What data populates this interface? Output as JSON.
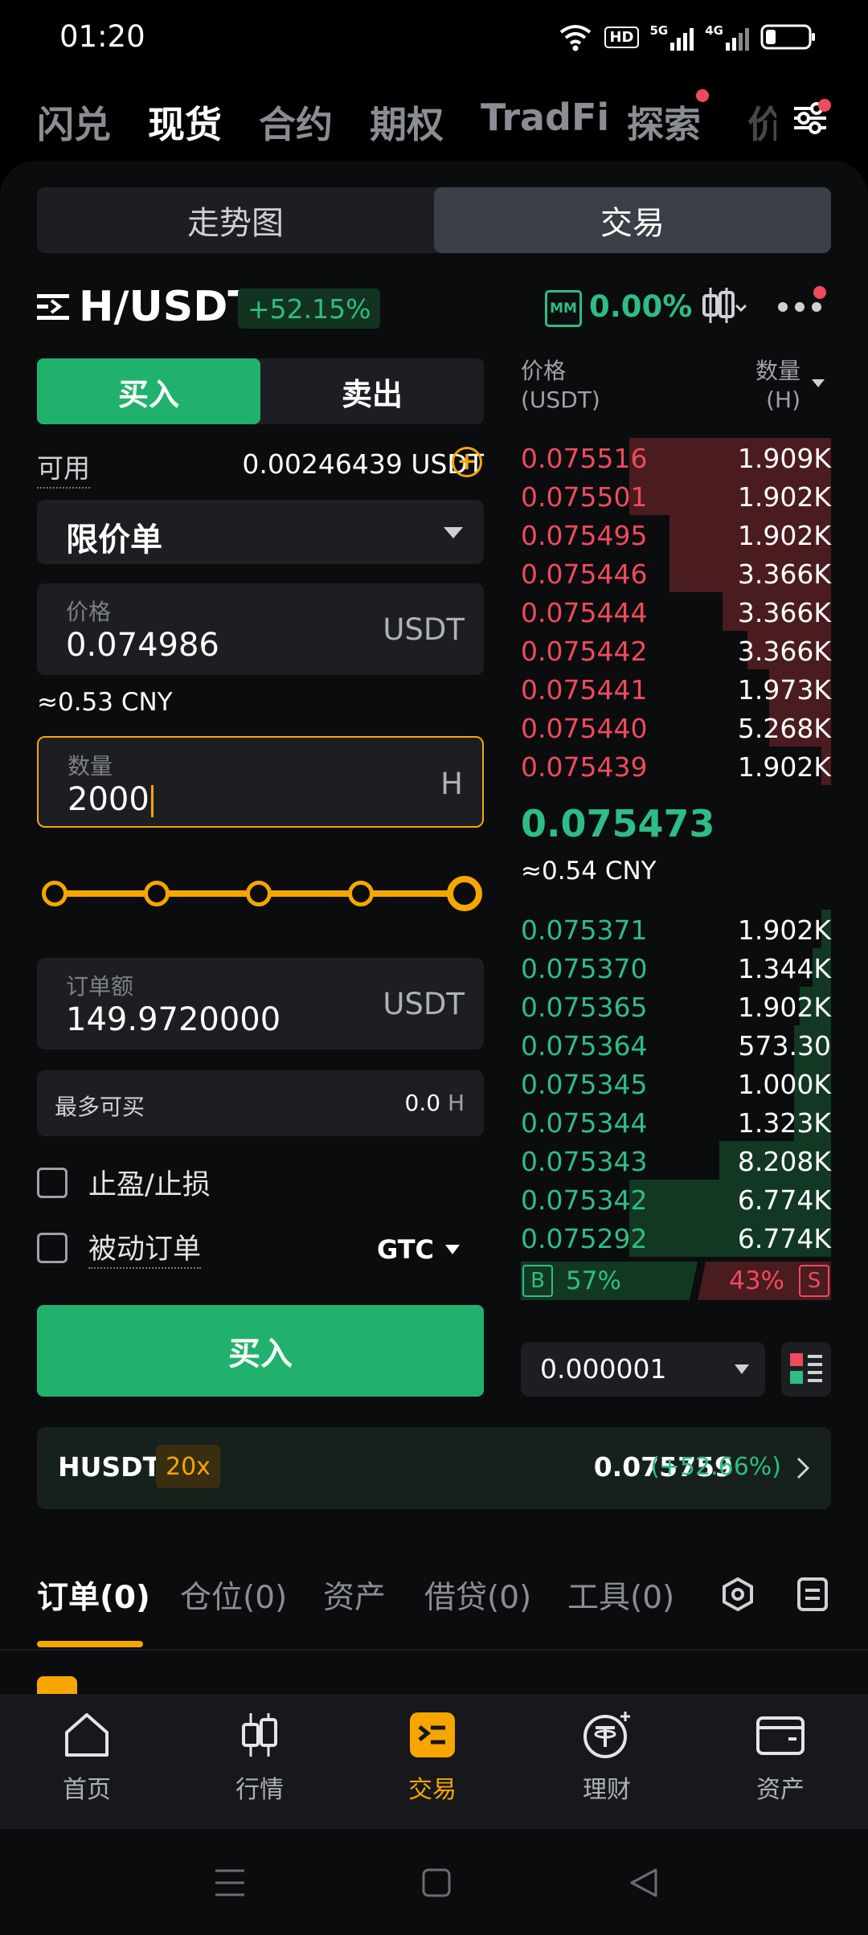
{
  "status": {
    "time": "01:20",
    "network1": "5G",
    "network2": "4G",
    "hd": "HD"
  },
  "top_tabs": [
    "闪兑",
    "现货",
    "合约",
    "期权",
    "TradFi",
    "探索",
    "价"
  ],
  "view_toggle": {
    "chart": "走势图",
    "trade": "交易"
  },
  "pair": {
    "symbol": "H/USDT",
    "change": "+52.15%",
    "mm_label": "MM",
    "mm_value": "0.00%"
  },
  "buy_sell": {
    "buy": "买入",
    "sell": "卖出"
  },
  "available": {
    "label": "可用",
    "value": "0.00246439 USDT"
  },
  "order_type": "限价单",
  "price": {
    "label": "价格",
    "value": "0.074986",
    "unit": "USDT",
    "approx": "≈0.53 CNY"
  },
  "quantity": {
    "label": "数量",
    "value": "2000",
    "unit": "H",
    "slider_fraction": 1.0
  },
  "amount": {
    "label": "订单额",
    "value": "149.9720000",
    "unit": "USDT"
  },
  "max_buy": {
    "label": "最多可买",
    "value": "0.0",
    "unit": "H"
  },
  "options": {
    "tpsl": "止盈/止损",
    "post_only": "被动订单",
    "tif": "GTC"
  },
  "buy_button": "买入",
  "orderbook": {
    "price_header": "价格",
    "price_unit": "(USDT)",
    "qty_header": "数量",
    "qty_unit": "(H)",
    "asks": [
      {
        "price": "0.075516",
        "qty": "1.909K",
        "depth": 0.65
      },
      {
        "price": "0.075501",
        "qty": "1.902K",
        "depth": 0.65
      },
      {
        "price": "0.075495",
        "qty": "1.902K",
        "depth": 0.52
      },
      {
        "price": "0.075446",
        "qty": "3.366K",
        "depth": 0.52
      },
      {
        "price": "0.075444",
        "qty": "3.366K",
        "depth": 0.35
      },
      {
        "price": "0.075442",
        "qty": "3.366K",
        "depth": 0.27
      },
      {
        "price": "0.075441",
        "qty": "1.973K",
        "depth": 0.2
      },
      {
        "price": "0.075440",
        "qty": "5.268K",
        "depth": 0.2
      },
      {
        "price": "0.075439",
        "qty": "1.902K",
        "depth": 0.03
      }
    ],
    "last_price": "0.075473",
    "last_cny": "≈0.54 CNY",
    "bids": [
      {
        "price": "0.075371",
        "qty": "1.902K",
        "depth": 0.03
      },
      {
        "price": "0.075370",
        "qty": "1.344K",
        "depth": 0.06
      },
      {
        "price": "0.075365",
        "qty": "1.902K",
        "depth": 0.1
      },
      {
        "price": "0.075364",
        "qty": "573.30",
        "depth": 0.12
      },
      {
        "price": "0.075345",
        "qty": "1.000K",
        "depth": 0.12
      },
      {
        "price": "0.075344",
        "qty": "1.323K",
        "depth": 0.12
      },
      {
        "price": "0.075343",
        "qty": "8.208K",
        "depth": 0.36
      },
      {
        "price": "0.075342",
        "qty": "6.774K",
        "depth": 0.65
      },
      {
        "price": "0.075292",
        "qty": "6.774K",
        "depth": 0.65
      }
    ],
    "buy_label": "B",
    "buy_pct": "57%",
    "sell_pct": "43%",
    "sell_label": "S",
    "precision": "0.000001"
  },
  "futures": {
    "name": "HUSDT",
    "leverage": "20x",
    "price": "0.075759",
    "change": "(+52.66%)"
  },
  "bottom_tabs": [
    "订单(0)",
    "仓位(0)",
    "资产",
    "借贷(0)",
    "工具(0)"
  ],
  "nav": [
    "首页",
    "行情",
    "交易",
    "理财",
    "资产"
  ],
  "colors": {
    "green": "#2ebd85",
    "red": "#f04a5c",
    "accent": "#f7a600"
  }
}
